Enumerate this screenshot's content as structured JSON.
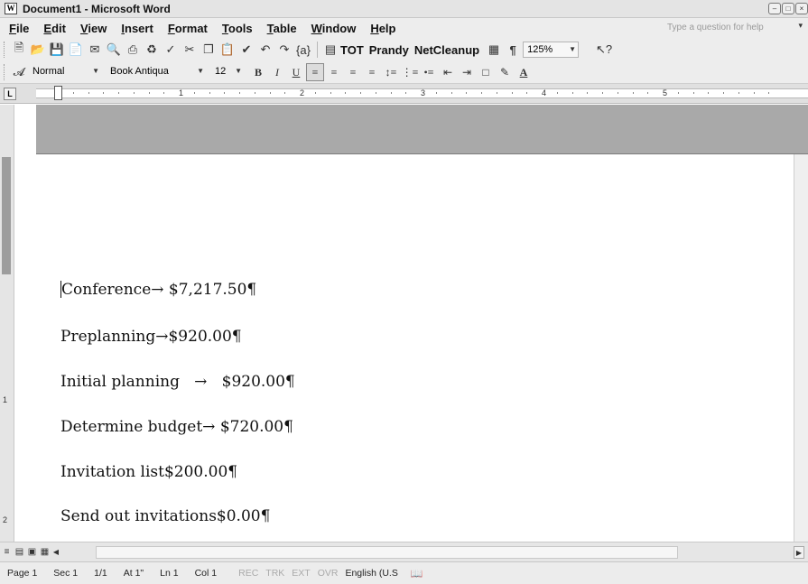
{
  "window": {
    "title": "Document1 - Microsoft Word",
    "icon": "word-doc-icon"
  },
  "menu": {
    "items": [
      "File",
      "Edit",
      "View",
      "Insert",
      "Format",
      "Tools",
      "Table",
      "Window",
      "Help"
    ],
    "help_placeholder": "Type a question for help"
  },
  "standard_toolbar": {
    "buttons_text": [
      "TOT",
      "Prandy",
      "NetCleanup"
    ],
    "zoom": "125%"
  },
  "formatting_toolbar": {
    "style": "Normal",
    "font": "Book Antiqua",
    "size": "12"
  },
  "ruler": {
    "numbers": [
      "1",
      "2",
      "3",
      "4",
      "5"
    ]
  },
  "vertical_ruler": {
    "numbers": [
      "1",
      "2"
    ]
  },
  "document": {
    "lines": [
      "Conference→ $7,217.50¶",
      "Preplanning→$920.00¶",
      "Initial planning   →   $920.00¶",
      "Determine budget→ $720.00¶",
      "Invitation list$200.00¶",
      "Send out invitations$0.00¶"
    ]
  },
  "status": {
    "page": "Page 1",
    "sec": "Sec 1",
    "pages": "1/1",
    "at": "At 1\"",
    "ln": "Ln 1",
    "col": "Col 1",
    "rec": "REC",
    "trk": "TRK",
    "ext": "EXT",
    "ovr": "OVR",
    "lang": "English (U.S"
  }
}
